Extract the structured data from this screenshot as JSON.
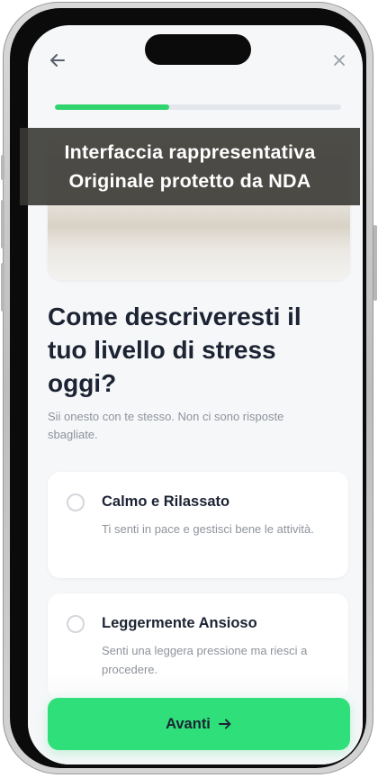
{
  "watermark": {
    "line1": "Interfaccia rappresentativa",
    "line2": "Originale protetto da NDA"
  },
  "progress": {
    "value_fraction": 0.4
  },
  "header": {
    "back_icon": "arrow-left-icon",
    "close_icon": "close-icon"
  },
  "question": {
    "title": "Come descriveresti il tuo livello di stress oggi?",
    "subtitle": "Sii onesto con te stesso. Non ci sono risposte sbagliate."
  },
  "options": [
    {
      "title": "Calmo e Rilassato",
      "description": "Ti senti in pace e gestisci bene le attività.",
      "selected": false
    },
    {
      "title": "Leggermente Ansioso",
      "description": "Senti una leggera pressione ma riesci a procedere.",
      "selected": false
    }
  ],
  "footer": {
    "next_label": "Avanti",
    "next_icon": "arrow-right-icon"
  },
  "colors": {
    "accent": "#2fe07a",
    "progress": "#2fd46e",
    "text": "#1c2333",
    "muted": "#8e939b"
  }
}
